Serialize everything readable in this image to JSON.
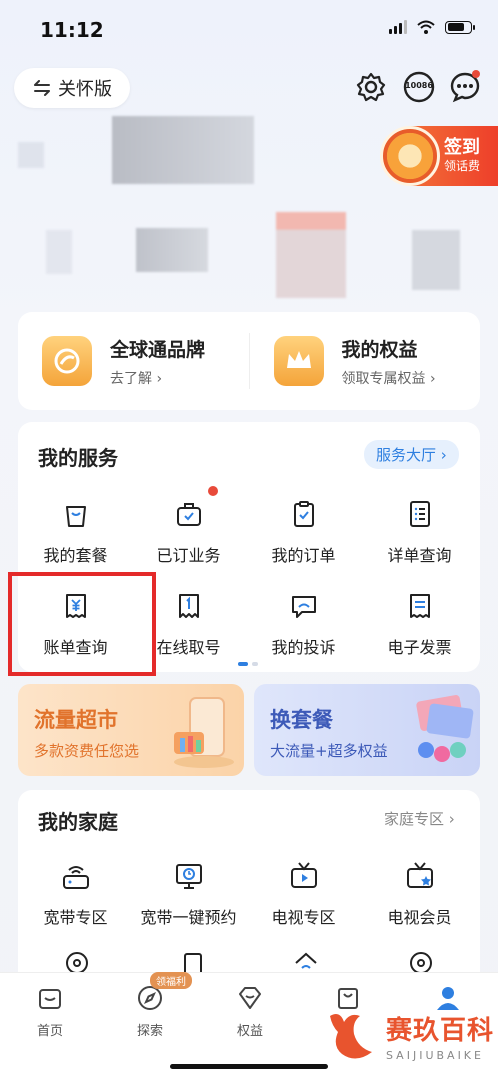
{
  "status_bar": {
    "time": "11:12"
  },
  "header": {
    "care_mode_label": "关怀版",
    "service_number": "10086"
  },
  "sign_in": {
    "title": "签到",
    "subtitle": "领话费"
  },
  "promo": {
    "items": [
      {
        "title": "全球通品牌",
        "subtitle": "去了解 ›"
      },
      {
        "title": "我的权益",
        "subtitle": "领取专属权益 ›"
      }
    ]
  },
  "services": {
    "title": "我的服务",
    "hall_button": "服务大厅 ›",
    "items": [
      {
        "label": "我的套餐",
        "icon": "bag-icon"
      },
      {
        "label": "已订业务",
        "icon": "briefcase-icon"
      },
      {
        "label": "我的订单",
        "icon": "clipboard-check-icon"
      },
      {
        "label": "详单查询",
        "icon": "list-icon"
      },
      {
        "label": "账单查询",
        "icon": "bill-yuan-icon"
      },
      {
        "label": "在线取号",
        "icon": "ticket-icon"
      },
      {
        "label": "我的投诉",
        "icon": "complaint-icon"
      },
      {
        "label": "电子发票",
        "icon": "invoice-icon"
      }
    ]
  },
  "banners": [
    {
      "title": "流量超市",
      "subtitle": "多款资费任您选",
      "color": "#e1732c"
    },
    {
      "title": "换套餐",
      "subtitle": "大流量+超多权益",
      "color": "#3d5ab8"
    }
  ],
  "family": {
    "title": "我的家庭",
    "link": "家庭专区 ›",
    "items": [
      {
        "label": "宽带专区",
        "icon": "router-icon"
      },
      {
        "label": "宽带一键预约",
        "icon": "monitor-clock-icon"
      },
      {
        "label": "电视专区",
        "icon": "tv-play-icon"
      },
      {
        "label": "电视会员",
        "icon": "tv-star-icon"
      }
    ]
  },
  "bottom_nav": {
    "items": [
      {
        "label": "首页",
        "icon": "home-icon"
      },
      {
        "label": "探索",
        "icon": "compass-icon"
      },
      {
        "label": "权益",
        "icon": "diamond-icon"
      },
      {
        "label": "",
        "icon": "shopping-bag-icon"
      },
      {
        "label": "",
        "icon": "profile-icon"
      }
    ],
    "new_tag": "领福利"
  },
  "watermark": {
    "title": "赛玖百科",
    "subtitle": "SAIJIUBAIKE"
  },
  "colors": {
    "accent_blue": "#2e7fe0",
    "highlight_red": "#e42a2a",
    "brand_orange": "#e8542e"
  }
}
